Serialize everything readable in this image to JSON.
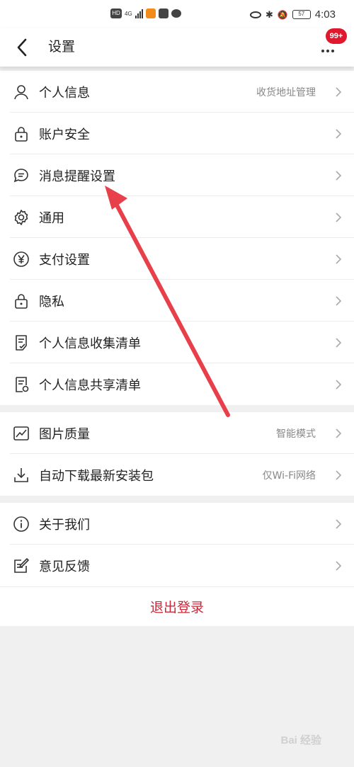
{
  "status_bar": {
    "left_tags": [
      "HD",
      "4G"
    ],
    "time": "4:03",
    "battery": "57"
  },
  "header": {
    "title": "设置",
    "badge": "99+"
  },
  "groups": [
    {
      "items": [
        {
          "icon": "person-icon",
          "label": "个人信息",
          "sub": "收货地址管理"
        },
        {
          "icon": "lock-icon",
          "label": "账户安全",
          "sub": ""
        },
        {
          "icon": "message-icon",
          "label": "消息提醒设置",
          "sub": ""
        },
        {
          "icon": "gear-icon",
          "label": "通用",
          "sub": ""
        },
        {
          "icon": "yen-icon",
          "label": "支付设置",
          "sub": ""
        },
        {
          "icon": "lock-icon",
          "label": "隐私",
          "sub": ""
        },
        {
          "icon": "checklist-icon",
          "label": "个人信息收集清单",
          "sub": ""
        },
        {
          "icon": "share-list-icon",
          "label": "个人信息共享清单",
          "sub": ""
        }
      ]
    },
    {
      "items": [
        {
          "icon": "image-icon",
          "label": "图片质量",
          "sub": "智能模式"
        },
        {
          "icon": "download-icon",
          "label": "自动下载最新安装包",
          "sub": "仅Wi-Fi网络"
        }
      ]
    },
    {
      "items": [
        {
          "icon": "info-icon",
          "label": "关于我们",
          "sub": ""
        },
        {
          "icon": "feedback-icon",
          "label": "意见反馈",
          "sub": ""
        }
      ]
    }
  ],
  "logout_label": "退出登录",
  "watermark": "Bai 经验",
  "colors": {
    "accent": "#c8283a",
    "badge": "#e0182e",
    "arrow": "#e8404a"
  }
}
